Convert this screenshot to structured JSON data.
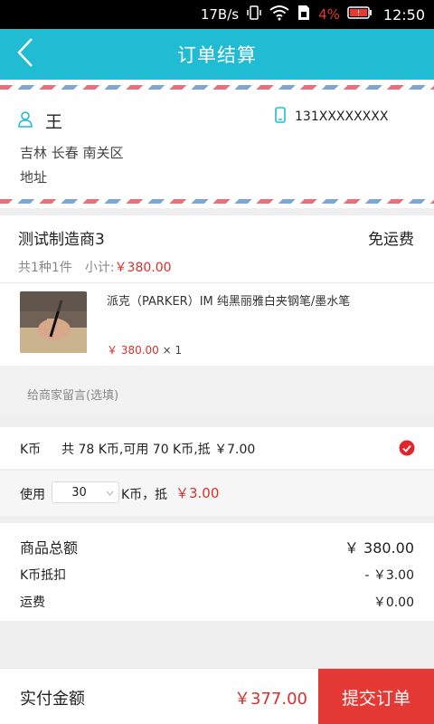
{
  "status_bar": {
    "network_speed": "17B/s",
    "battery_percent": "4%",
    "time": "12:50"
  },
  "header": {
    "title": "订单结算",
    "back_icon": "chevron-left-icon"
  },
  "address": {
    "name": "王",
    "phone": "131XXXXXXXX",
    "region": "吉林 长春 南关区",
    "detail": "地址",
    "accent_color": "#1fbcd3"
  },
  "shop": {
    "name": "测试制造商3",
    "shipping": "免运费",
    "count_text": "共1种1件",
    "subtotal_label": "小计:",
    "subtotal_value": "￥380.00",
    "product": {
      "name": "派克（PARKER）IM 纯黑丽雅白夹钢笔/墨水笔",
      "price": "￥ 380.00",
      "quantity": "× 1"
    }
  },
  "message": {
    "placeholder": "给商家留言(选填)"
  },
  "coins": {
    "label": "K币",
    "info": "共 78 K币,可用 70 K币,抵 ￥7.00",
    "checked": true,
    "use_label": "使用",
    "use_value": "30",
    "unit_text": "K币，抵",
    "deduct_value": "￥3.00"
  },
  "totals": {
    "goods_label": "商品总额",
    "goods_value": "￥ 380.00",
    "coin_label": "K币抵扣",
    "coin_value": "- ￥3.00",
    "shipping_label": "运费",
    "shipping_value": "￥0.00"
  },
  "footer": {
    "pay_label": "实付金额",
    "pay_amount": "￥377.00",
    "submit_label": "提交订单",
    "submit_color": "#e53935",
    "price_color": "#d9302a"
  }
}
